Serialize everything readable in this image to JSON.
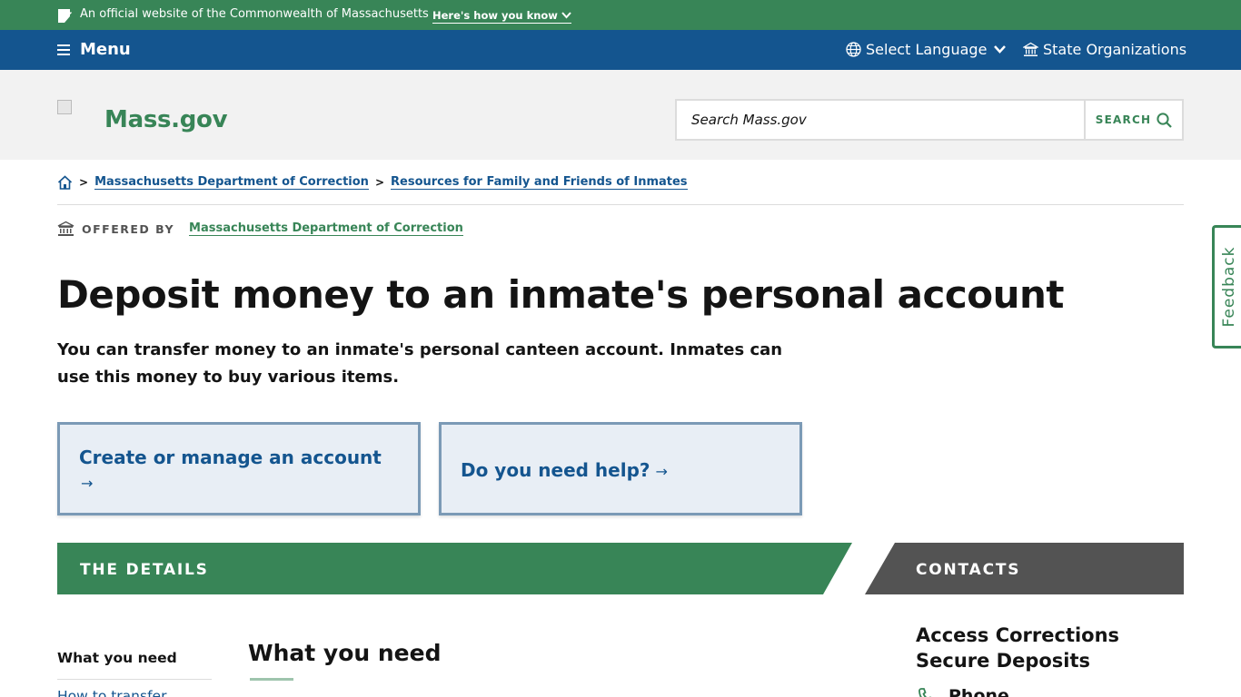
{
  "official_bar": {
    "text": "An official website of the Commonwealth of Massachusetts",
    "how_label": "Here's how you know"
  },
  "nav": {
    "menu_label": "Menu",
    "language_label": "Select Language",
    "orgs_label": "State Organizations"
  },
  "header": {
    "site_name": "Mass.gov",
    "search_placeholder": "Search Mass.gov",
    "search_button": "SEARCH"
  },
  "breadcrumb": {
    "items": [
      "Massachusetts Department of Correction",
      "Resources for Family and Friends of Inmates"
    ]
  },
  "offered_by": {
    "label": "OFFERED BY",
    "org": "Massachusetts Department of Correction"
  },
  "page": {
    "title": "Deposit money to an inmate's personal account",
    "lede": "You can transfer money to an inmate's personal canteen account. Inmates can use this money to buy various items."
  },
  "key_actions": [
    {
      "label": "Create or manage an account",
      "arrow": "→"
    },
    {
      "label": "Do you need help?",
      "arrow": "→"
    }
  ],
  "bands": {
    "details": "THE DETAILS",
    "contacts": "CONTACTS"
  },
  "toc": {
    "items": [
      "What you need",
      "How to transfer"
    ]
  },
  "section": {
    "title": "What you need"
  },
  "contact": {
    "name": "Access Corrections Secure Deposits",
    "phone_label": "Phone"
  },
  "feedback": {
    "label": "Feedback"
  },
  "colors": {
    "green": "#388557",
    "blue": "#14558f",
    "gray_band": "#535353",
    "light_gray": "#f2f2f2"
  }
}
